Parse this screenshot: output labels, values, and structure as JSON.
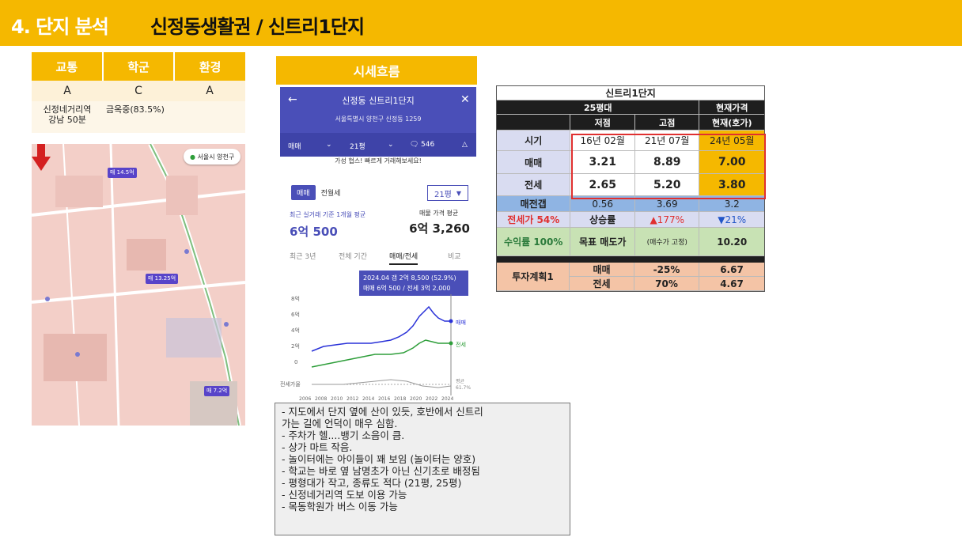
{
  "header": {
    "title": "4. 단지 분석",
    "subtitle": "신정동생활권 / 신트리1단지"
  },
  "rating": {
    "headers": [
      "교통",
      "학군",
      "환경"
    ],
    "grades": [
      "A",
      "C",
      "A"
    ],
    "notes": [
      "신정네거리역\n강남 50분",
      "금옥중(83.5%)",
      ""
    ]
  },
  "map": {
    "chip_text": "서울시 양천구",
    "tags": [
      "매 14.5억",
      "매 13.25억",
      "매 7.2억"
    ]
  },
  "price_flow": {
    "label": "시세흐름",
    "app": {
      "title": "신정동 신트리1단지",
      "address": "서울특별시 양천구 신정동 1259",
      "tab_deal": "매매",
      "tab_size": "21평",
      "tab_comments": "546",
      "banner": "가성 협스! 빠르게 거래해보세요!",
      "seg_on": "매매",
      "seg_off": "전월세",
      "size_select": "21평",
      "recent_label": "최근 실거래 기준 1개월 평균",
      "recent_value": "6억 500",
      "avg_label": "매물 가격 평균",
      "avg_value": "6억 3,260",
      "periods": [
        "최근 3년",
        "전체 기간",
        "매매/전세",
        "비교"
      ],
      "tooltip_line1": "2024.04  갭 2억 8,500 (52.9%)",
      "tooltip_line2": "매매 6억 500 / 전세 3억 2,000",
      "y_ticks": [
        "8억",
        "6억",
        "4억",
        "2억",
        "0"
      ],
      "series_sale": "매매",
      "series_jeonse": "전세",
      "ratio_label": "전세가율",
      "avg_pct_label": "평균",
      "avg_pct_value": "61.7%",
      "x_ticks": [
        "2006",
        "2008",
        "2010",
        "2012",
        "2014",
        "2016",
        "2018",
        "2020",
        "2022",
        "2024"
      ]
    }
  },
  "data_table": {
    "title": "신트리1단지",
    "size_label": "25평대",
    "current_label": "현재가격",
    "col_low": "저점",
    "col_high": "고점",
    "col_current": "현재(호가)",
    "rows": {
      "period": {
        "label": "시기",
        "low": "16년 02월",
        "high": "21년 07월",
        "cur": "24년 05월"
      },
      "sale": {
        "label": "매매",
        "low": "3.21",
        "high": "8.89",
        "cur": "7.00"
      },
      "jeonse": {
        "label": "전세",
        "low": "2.65",
        "high": "5.20",
        "cur": "3.80"
      },
      "gap": {
        "label": "매전갭",
        "low": "0.56",
        "high": "3.69",
        "cur": "3.2"
      },
      "ratio": {
        "label": "전세가 54%",
        "mid": "상승률",
        "high": "▲177%",
        "cur": "▼21%"
      },
      "yield": {
        "label": "수익률 100%",
        "mid": "목표 매도가",
        "high": "(매수가 고정)",
        "cur": "10.20"
      },
      "plan": {
        "label": "투자계획1",
        "sale_label": "매매",
        "sale_pct": "-25%",
        "sale_val": "6.67",
        "jeonse_label": "전세",
        "jeonse_pct": "70%",
        "jeonse_val": "4.67"
      }
    }
  },
  "notes": [
    "지도에서 단지 옆에 산이 있듯, 호반에서 신트리\n   가는 길에 언덕이 매우 심함.",
    "주차가 헬....뱅기 소음이 큼.",
    "상가 마트 작음.",
    "놀이터에는 아이들이 꽤 보임 (놀이터는 양호)",
    "학교는 바로 옆 남명초가 아닌 신기초로 배정됨",
    "평형대가 작고, 종류도 적다 (21평, 25평)",
    "신정네거리역 도보 이용 가능",
    "목동학원가 버스 이동 가능"
  ],
  "colors": {
    "brand_yellow": "#f5b800",
    "app_blue": "#4a4fb8",
    "sale_line": "#2a32d8",
    "jeonse_line": "#2e9e3a",
    "highlight_red": "#e03030"
  }
}
